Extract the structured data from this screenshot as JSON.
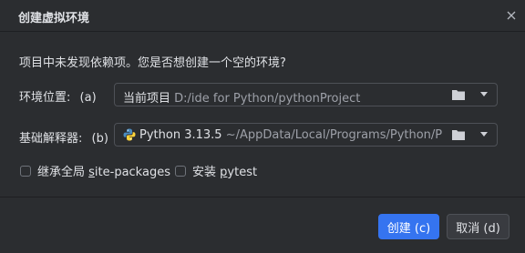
{
  "dialog": {
    "title": "创建虚拟环境",
    "close_icon": "close-icon",
    "message": "项目中未发现依赖项。您是否想创建一个空的环境?"
  },
  "location": {
    "label": "环境位置:",
    "mnemonic": "(a)",
    "prefix": "当前项目",
    "path": "D:/ide for Python/pythonProject",
    "folder_icon": "folder-icon",
    "dropdown_icon": "chevron-down-icon"
  },
  "interpreter": {
    "label": "基础解释器:",
    "mnemonic": "(b)",
    "version": "Python 3.13.5",
    "path": "~/AppData/Local/Programs/Python/Pyth...",
    "python_icon": "python-icon",
    "folder_icon": "folder-icon",
    "dropdown_icon": "chevron-down-icon"
  },
  "options": [
    {
      "label_prefix": "继承全局 ",
      "label_mn": "s",
      "label_rest": "ite-packages",
      "checked": false
    },
    {
      "label_prefix": "安装 ",
      "label_mn": "p",
      "label_rest": "ytest",
      "checked": false
    }
  ],
  "buttons": {
    "create": "创建 (c)",
    "cancel": "取消 (d)"
  },
  "colors": {
    "background": "#2b2d30",
    "accent": "#3574f0",
    "text": "#dfe1e5",
    "muted": "#9da0a8"
  }
}
